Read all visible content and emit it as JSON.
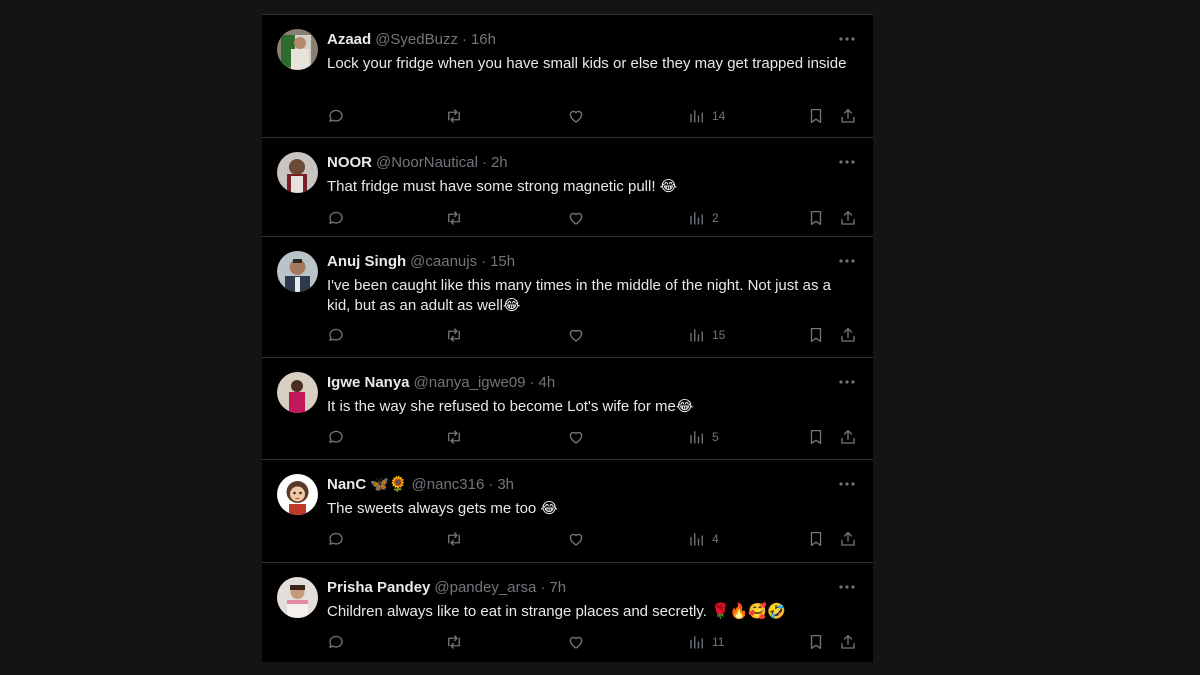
{
  "colors": {
    "page_background": "#141417",
    "feed_background": "#000000",
    "primary_text": "#e7e9ea",
    "secondary_text": "#71767b",
    "divider": "#2f3336"
  },
  "icons": {
    "reply": "reply-icon",
    "retweet": "retweet-icon",
    "like": "heart-icon",
    "views": "views-icon",
    "bookmark": "bookmark-icon",
    "share": "share-icon",
    "more": "more-icon"
  },
  "tweets": [
    {
      "name": "Azaad",
      "handle": "@SyedBuzz",
      "time": "16h",
      "text": "Lock your fridge when you have small kids or else they may get trapped inside",
      "views": "14"
    },
    {
      "name": "NOOR",
      "handle": "@NoorNautical",
      "time": "2h",
      "text": "That fridge must have some strong magnetic pull! 😂",
      "views": "2"
    },
    {
      "name": "Anuj Singh",
      "handle": "@caanujs",
      "time": "15h",
      "text": "I've been caught like this many times in the middle of the night. Not just as a kid, but as an adult as well😂",
      "views": "15"
    },
    {
      "name": "Igwe Nanya",
      "handle": "@nanya_igwe09",
      "time": "4h",
      "text": "It is the way she refused to become Lot's wife for me😂",
      "views": "5"
    },
    {
      "name": "NanC",
      "name_emoji": "🦋🌻",
      "handle": "@nanc316",
      "time": "3h",
      "text": "The sweets always gets me too 😂",
      "views": "4"
    },
    {
      "name": "Prisha Pandey",
      "handle": "@pandey_arsa",
      "time": "7h",
      "text": "Children always like to eat in strange places and secretly. 🌹🔥🥰🤣",
      "views": "11"
    }
  ]
}
